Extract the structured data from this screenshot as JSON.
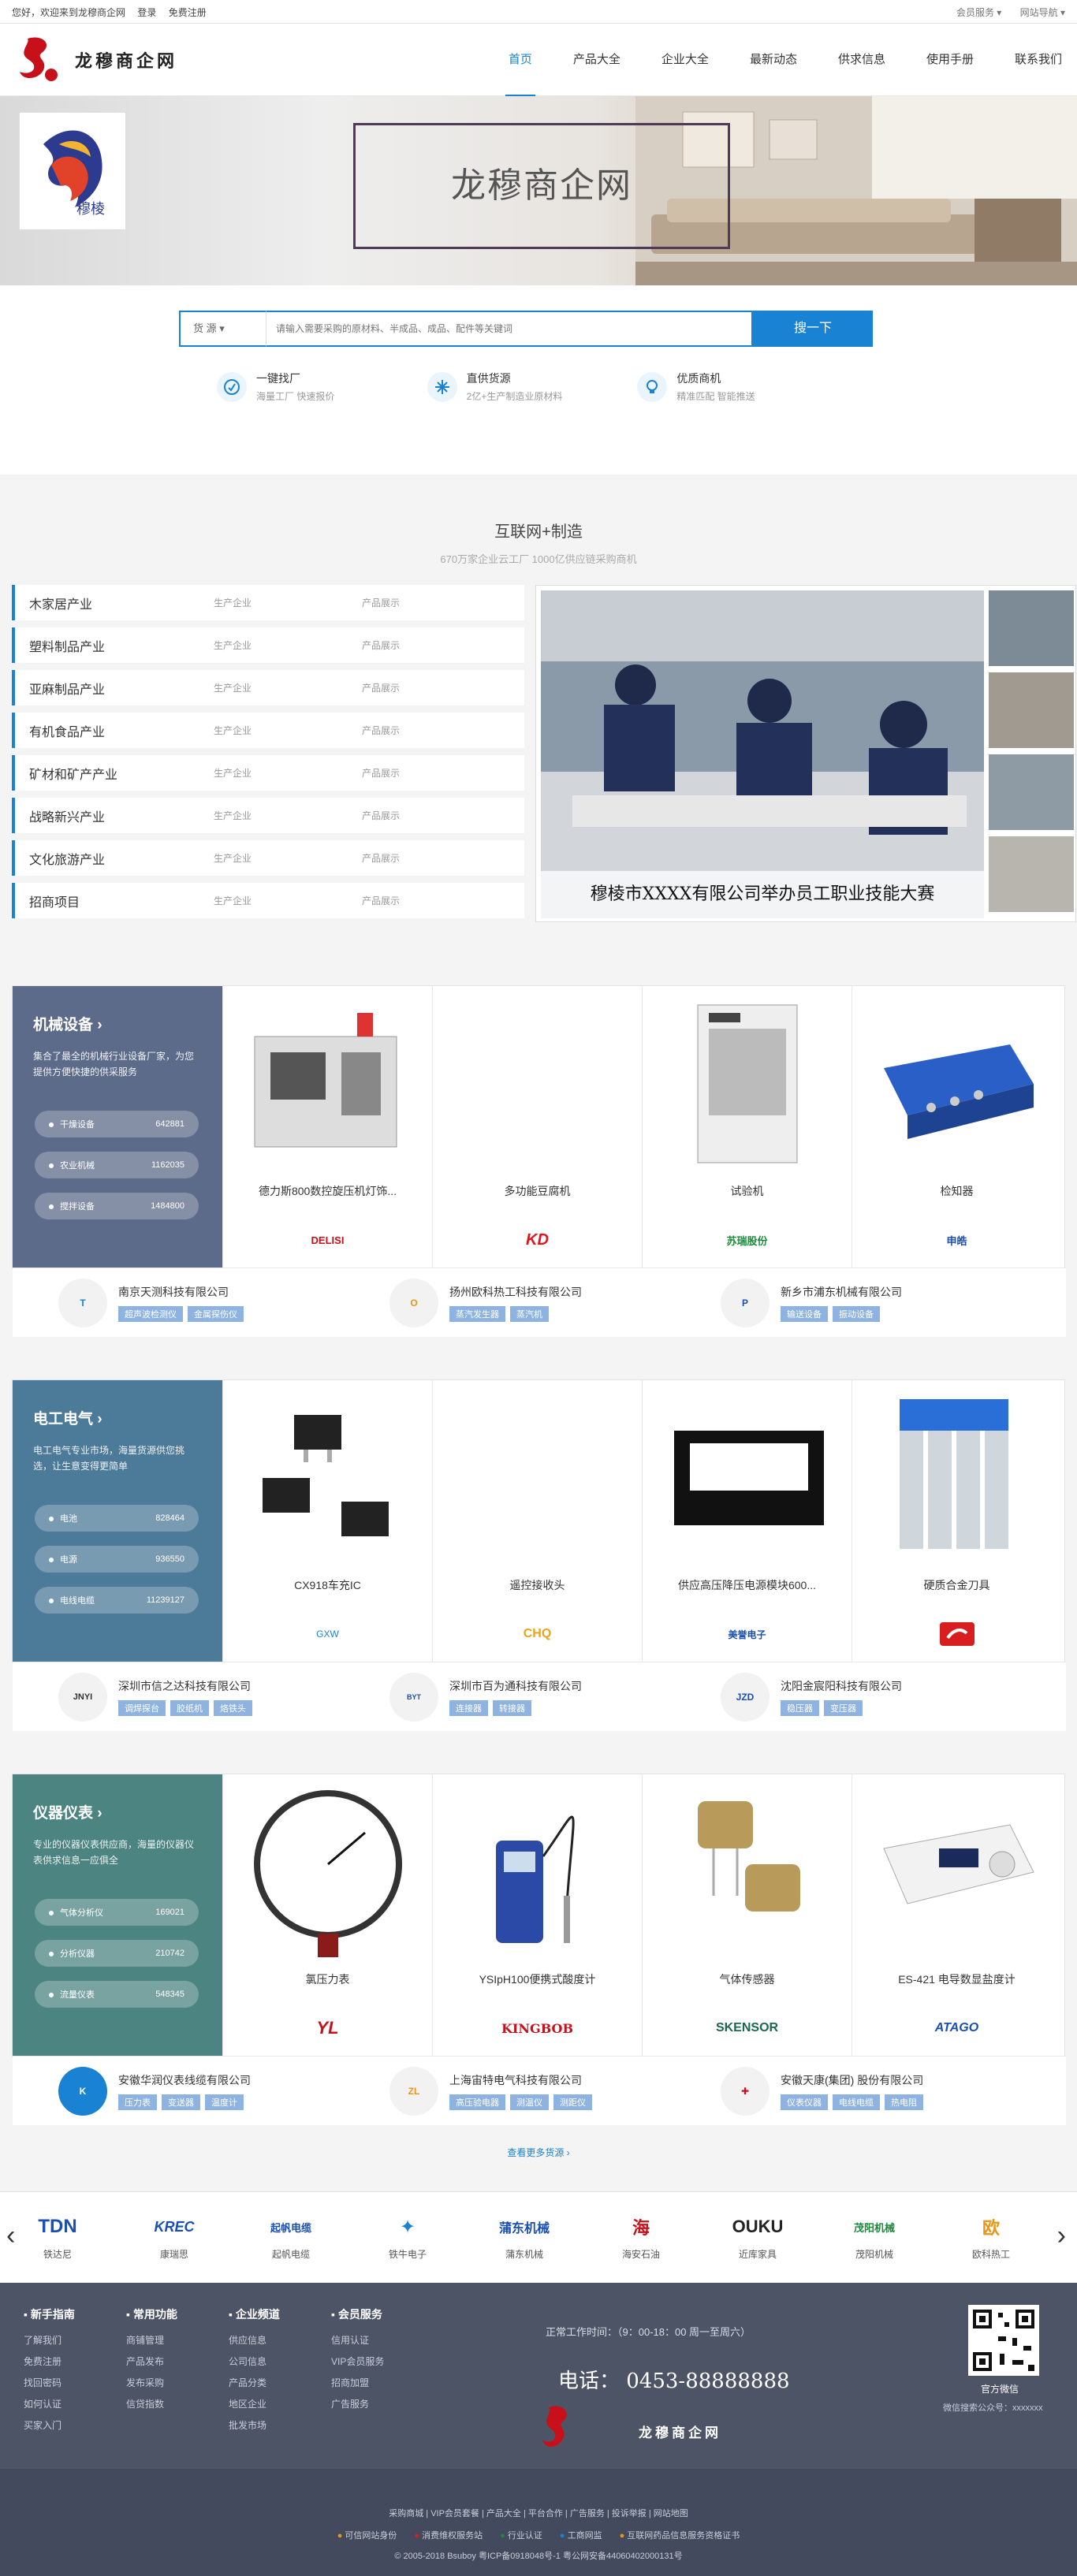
{
  "topbar": {
    "welcome": "您好，欢迎来到龙穆商企网",
    "login": "登录",
    "register": "免费注册",
    "member": "会员服务 ▾",
    "nav": "网站导航 ▾"
  },
  "header": {
    "site_name": "龙穆商企网",
    "nav": [
      "首页",
      "产品大全",
      "企业大全",
      "最新动态",
      "供求信息",
      "使用手册",
      "联系我们"
    ]
  },
  "banner": {
    "title": "龙穆商企网",
    "badge_text": "穆棱"
  },
  "search": {
    "type": "货 源",
    "placeholder": "请输入需要采购的原材料、半成品、成品、配件等关键词",
    "button": "搜一下"
  },
  "features": [
    {
      "title": "一键找厂",
      "desc": "海量工厂 快速报价"
    },
    {
      "title": "直供货源",
      "desc": "2亿+生产制造业原材料"
    },
    {
      "title": "优质商机",
      "desc": "精准匹配 智能推送"
    }
  ],
  "industry": {
    "title": "互联网+制造",
    "subtitle": "670万家企业云工厂 1000亿供应链采购商机",
    "col1": "生产企业",
    "col2": "产品展示",
    "rows": [
      "木家居产业",
      "塑料制品产业",
      "亚麻制品产业",
      "有机食品产业",
      "矿材和矿产产业",
      "战略新兴产业",
      "文化旅游产业",
      "招商项目"
    ],
    "caption": "穆棱市XXXX有限公司举办员工职业技能大赛"
  },
  "categories": [
    {
      "title": "机械设备 ›",
      "desc": "集合了最全的机械行业设备厂家，为您提供方便快捷的供采服务",
      "stats": [
        {
          "name": "干燥设备",
          "count": "642881"
        },
        {
          "name": "农业机械",
          "count": "1162035"
        },
        {
          "name": "搅拌设备",
          "count": "1484800"
        }
      ],
      "products": [
        {
          "name": "德力斯800数控旋压机灯饰...",
          "brand": "DELISI"
        },
        {
          "name": "多功能豆腐机",
          "brand": "KD"
        },
        {
          "name": "试验机",
          "brand": "苏瑞股份"
        },
        {
          "name": "检知器",
          "brand": "申皓"
        }
      ],
      "companies": [
        {
          "name": "南京天测科技有限公司",
          "tags": [
            "超声波检测仪",
            "金属探伤仪"
          ]
        },
        {
          "name": "扬州欧科热工科技有限公司",
          "tags": [
            "蒸汽发生器",
            "蒸汽机"
          ]
        },
        {
          "name": "新乡市浦东机械有限公司",
          "tags": [
            "输送设备",
            "振动设备"
          ]
        }
      ]
    },
    {
      "title": "电工电气 ›",
      "desc": "电工电气专业市场，海量货源供您挑选，让生意变得更简单",
      "stats": [
        {
          "name": "电池",
          "count": "828464"
        },
        {
          "name": "电源",
          "count": "936550"
        },
        {
          "name": "电线电缆",
          "count": "11239127"
        }
      ],
      "products": [
        {
          "name": "CX918车充IC",
          "brand": "GXW"
        },
        {
          "name": "遥控接收头",
          "brand": "CHQ"
        },
        {
          "name": "供应高压降压电源模块600...",
          "brand": "美誉电子"
        },
        {
          "name": "硬质合金刀具",
          "brand": ""
        }
      ],
      "companies": [
        {
          "name": "深圳市信之达科技有限公司",
          "tags": [
            "调焊探台",
            "胶纸机",
            "烙铁头"
          ]
        },
        {
          "name": "深圳市百为通科技有限公司",
          "tags": [
            "连接器",
            "转接器"
          ]
        },
        {
          "name": "沈阳金宸阳科技有限公司",
          "tags": [
            "稳压器",
            "变压器"
          ]
        }
      ]
    },
    {
      "title": "仪器仪表 ›",
      "desc": "专业的仪器仪表供应商，海量的仪器仪表供求信息一应俱全",
      "stats": [
        {
          "name": "气体分析仪",
          "count": "169021"
        },
        {
          "name": "分析仪器",
          "count": "210742"
        },
        {
          "name": "流量仪表",
          "count": "548345"
        }
      ],
      "products": [
        {
          "name": "氯压力表",
          "brand": "YL"
        },
        {
          "name": "YSIpH100便携式酸度计",
          "brand": "KINGBOB"
        },
        {
          "name": "气体传感器",
          "brand": "SKENSOR"
        },
        {
          "name": "ES-421 电导数显盐度计",
          "brand": "ATAGO"
        }
      ],
      "companies": [
        {
          "name": "安徽华润仪表线缆有限公司",
          "tags": [
            "压力表",
            "变送器",
            "温度计"
          ]
        },
        {
          "name": "上海宙特电气科技有限公司",
          "tags": [
            "高压验电器",
            "测温仪",
            "测距仪"
          ]
        },
        {
          "name": "安徽天康(集团) 股份有限公司",
          "tags": [
            "仪表仪器",
            "电线电缆",
            "热电阻"
          ]
        }
      ]
    }
  ],
  "more_link": "查看更多货源 ›",
  "brands": [
    {
      "logo": "TDN",
      "name": "铁达尼"
    },
    {
      "logo": "KREC",
      "name": "康瑞思"
    },
    {
      "logo": "起帆电缆",
      "name": "起帆电缆"
    },
    {
      "logo": "✦",
      "name": "铁牛电子"
    },
    {
      "logo": "蒲东机械",
      "name": "蒲东机械"
    },
    {
      "logo": "海",
      "name": "海安石油"
    },
    {
      "logo": "OUKU",
      "name": "近库家具"
    },
    {
      "logo": "茂阳机械",
      "name": "茂阳机械"
    },
    {
      "logo": "欧",
      "name": "欧科热工"
    }
  ],
  "footer": {
    "cols": [
      {
        "title": "新手指南",
        "items": [
          "了解我们",
          "免费注册",
          "找回密码",
          "如何认证",
          "买家入门"
        ]
      },
      {
        "title": "常用功能",
        "items": [
          "商铺管理",
          "产品发布",
          "发布采购",
          "信贷指数"
        ]
      },
      {
        "title": "企业频道",
        "items": [
          "供应信息",
          "公司信息",
          "产品分类",
          "地区企业",
          "批发市场"
        ]
      },
      {
        "title": "会员服务",
        "items": [
          "信用认证",
          "VIP会员服务",
          "招商加盟",
          "广告服务"
        ]
      }
    ],
    "hours": "正常工作时间：（9：00-18：00 周一至周六）",
    "phone": "电话： 0453-88888888",
    "logo_name": "龙穆商企网",
    "wechat": "官方微信",
    "wechat_id": "微信搜索公众号：xxxxxxx",
    "links": "采购商城 | VIP会员套餐 | 产品大全 | 平台合作 | 广告服务 | 投诉举报 | 网站地图",
    "badges": [
      "可信网站身份",
      "消费维权服务站",
      "行业认证",
      "工商网监",
      "互联网药品信息服务资格证书"
    ],
    "copyright": "© 2005-2018 Bsuboy 粤ICP备0918048号-1 粤公网安备44060402000131号"
  }
}
